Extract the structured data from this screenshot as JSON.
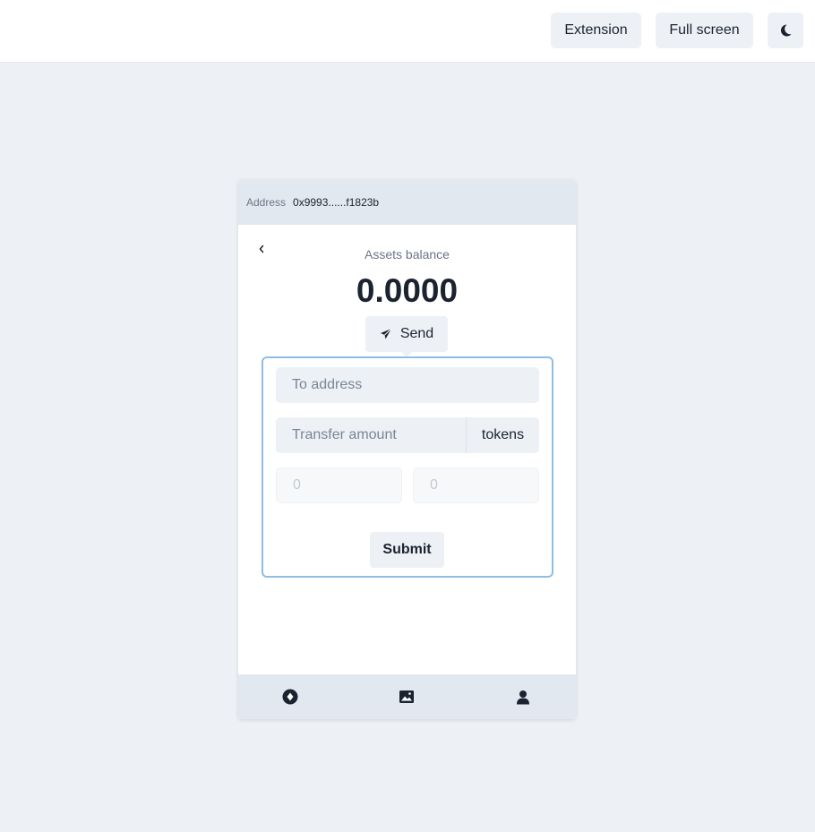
{
  "topbar": {
    "extension_label": "Extension",
    "fullscreen_label": "Full screen",
    "theme_icon": "moon-icon"
  },
  "wallet": {
    "address_label": "Address",
    "address_value": "0x9993......f1823b",
    "assets_label": "Assets balance",
    "balance": "0.0000",
    "send_label": "Send",
    "send_icon": "paper-plane-icon",
    "form": {
      "to_address_placeholder": "To address",
      "amount_placeholder": "Transfer amount",
      "amount_unit": "tokens",
      "field_a_placeholder": "0",
      "field_b_placeholder": "0",
      "submit_label": "Submit"
    },
    "nav": [
      "compass-icon",
      "image-icon",
      "user-icon"
    ]
  },
  "colors": {
    "page_bg": "#edf1f5",
    "panel_border": "#8fbde3",
    "header_bg": "#e2e8f0",
    "text": "#1c2330"
  }
}
